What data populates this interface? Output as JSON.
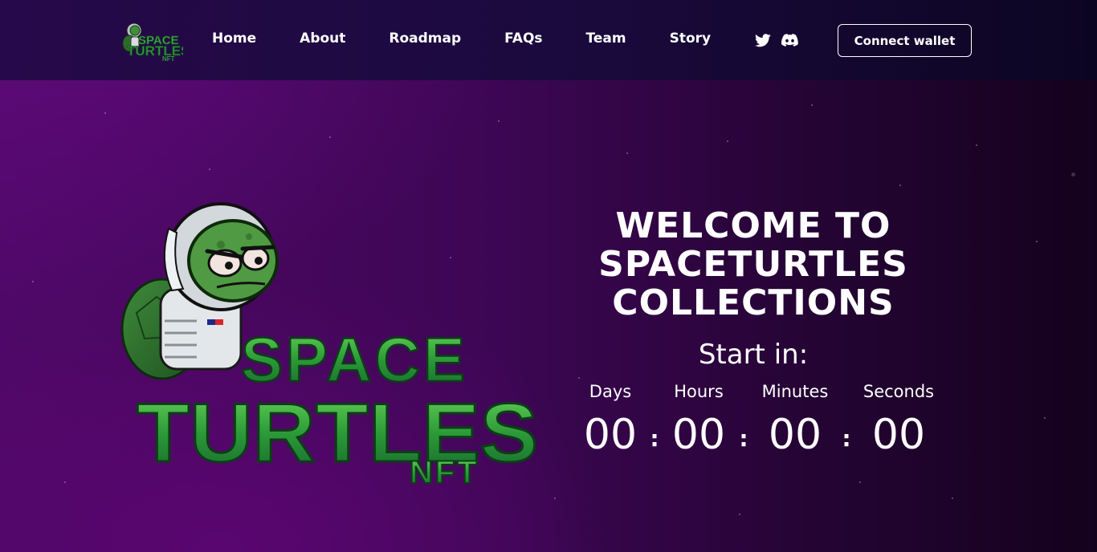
{
  "brand": {
    "logo_line1": "SPACE",
    "logo_line2": "TURTLES",
    "logo_line3": "NFT",
    "colors": {
      "green": "#2e9c3a",
      "green_light": "#5fcf52",
      "green_dark": "#15602a"
    }
  },
  "nav": {
    "items": [
      {
        "label": "Home"
      },
      {
        "label": "About"
      },
      {
        "label": "Roadmap"
      },
      {
        "label": "FAQs"
      },
      {
        "label": "Team"
      },
      {
        "label": "Story"
      }
    ],
    "social": [
      {
        "icon": "twitter-icon"
      },
      {
        "icon": "discord-icon"
      }
    ],
    "connect_label": "Connect wallet"
  },
  "hero": {
    "welcome_line1": "WELCOME TO",
    "welcome_line2": "SPACETURTLES",
    "welcome_line3": "COLLECTIONS",
    "start_label": "Start in:",
    "countdown": [
      {
        "label": "Days",
        "value": "00"
      },
      {
        "label": "Hours",
        "value": "00"
      },
      {
        "label": "Minutes",
        "value": "00"
      },
      {
        "label": "Seconds",
        "value": "00"
      }
    ],
    "separator": ":"
  }
}
